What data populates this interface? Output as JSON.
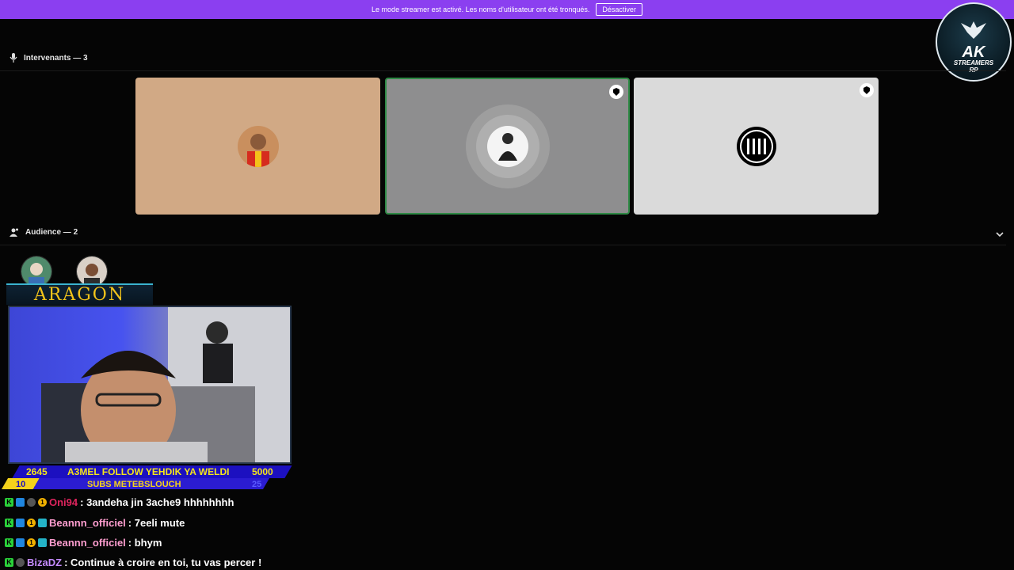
{
  "banner": {
    "message": "Le mode streamer est activé. Les noms d'utilisateur ont été tronqués.",
    "button_label": "Désactiver"
  },
  "speakers": {
    "header": "Intervenants — 3"
  },
  "audience": {
    "header": "Audience — 2"
  },
  "logo": {
    "line1": "AK",
    "line2": "STREAMERS",
    "line3": "RP"
  },
  "overlay": {
    "streamer_name": "ARAGON",
    "goal": {
      "left_value": "2645",
      "message": "A3MEL FOLLOW YEHDIK YA WELDI",
      "right_value": "5000",
      "sub_left": "10",
      "sub_label": "SUBS  METEBSLOUCH",
      "sub_right": "25"
    }
  },
  "chat": [
    {
      "user": "Oni94",
      "text": ": 3andeha jin 3ache9 hhhhhhhh",
      "color": "#e0245e"
    },
    {
      "user": "Beannn_officiel",
      "text": ": 7eeli mute",
      "color": "#ff9ed0"
    },
    {
      "user": "Beannn_officiel",
      "text": ": bhym",
      "color": "#ff9ed0"
    },
    {
      "user": "BizaDZ",
      "text": ": Continue à croire en toi, tu vas percer !",
      "color": "#c58cff"
    }
  ],
  "colors": {
    "accent": "#8b3ff0",
    "speaking_border": "#2f8a46"
  }
}
